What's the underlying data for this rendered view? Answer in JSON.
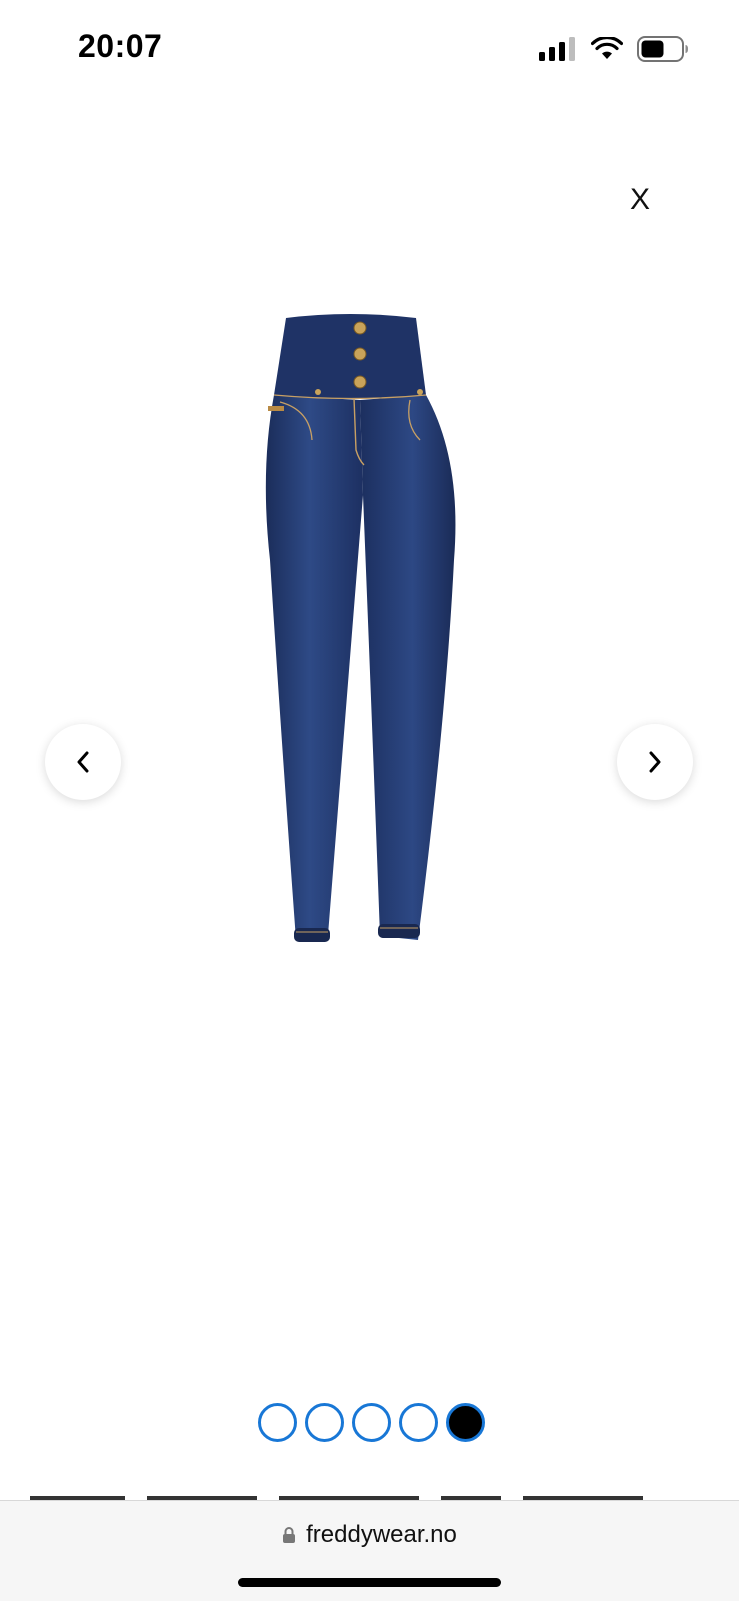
{
  "status_bar": {
    "time": "20:07",
    "icons": [
      "cellular-signal-icon",
      "wifi-icon",
      "battery-icon"
    ]
  },
  "modal": {
    "close_label": "X",
    "image_alt": "jeans-product-image",
    "prev_icon": "chevron-left-icon",
    "next_icon": "chevron-right-icon",
    "carousel": {
      "total": 5,
      "active_index": 4
    }
  },
  "browser": {
    "url": "freddywear.no",
    "icon": "lock-icon"
  },
  "colors": {
    "dot_border": "#1877d6",
    "dot_active": "#000000",
    "denim": "#233a6e"
  }
}
